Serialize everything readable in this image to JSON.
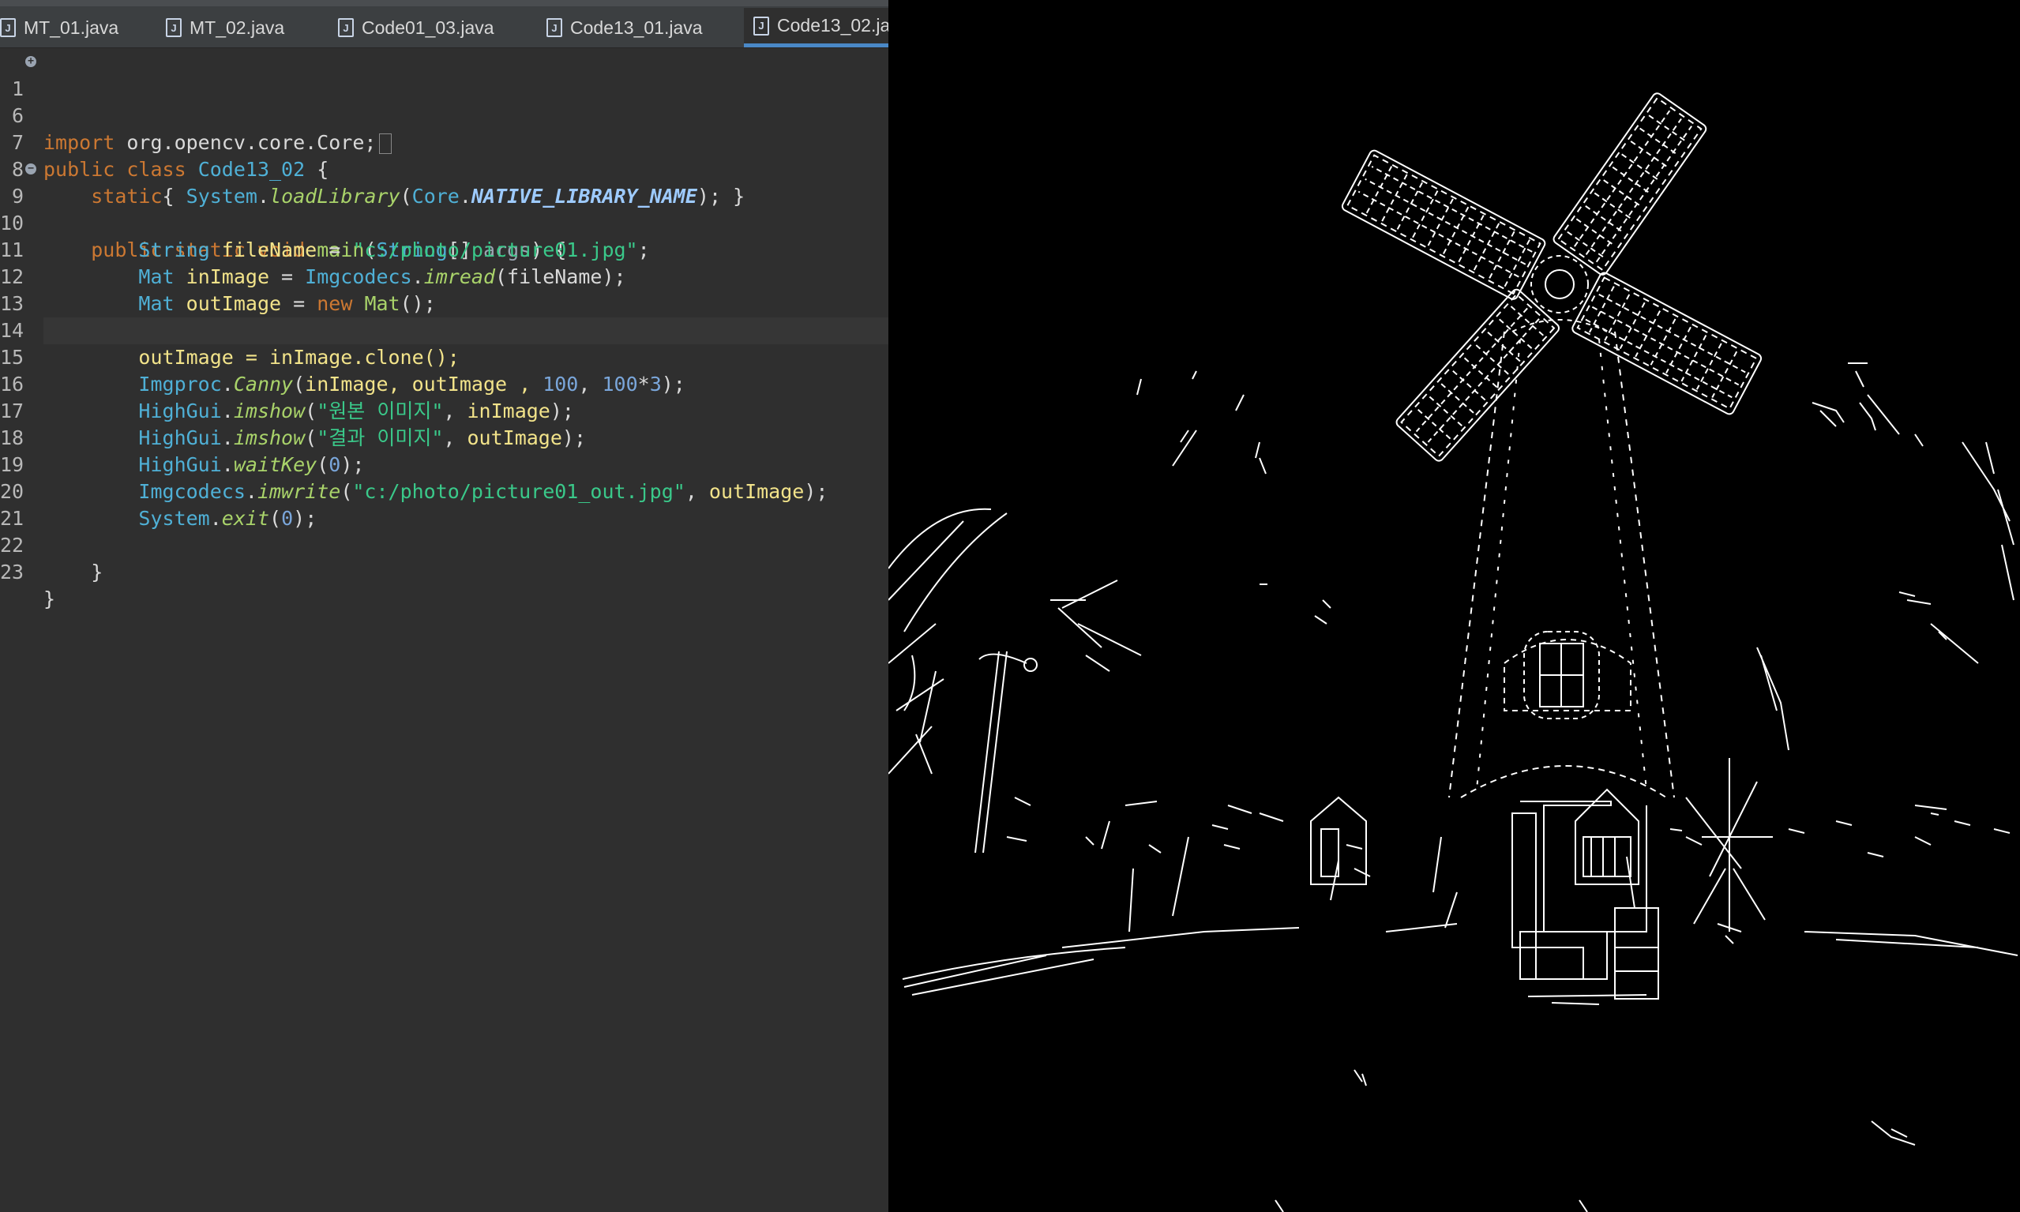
{
  "editor": {
    "tabs": [
      {
        "label": "MT_01.java"
      },
      {
        "label": "MT_02.java"
      },
      {
        "label": "Code01_03.java"
      },
      {
        "label": "Code13_01.java"
      },
      {
        "label": "Code13_02.ja",
        "active": true
      }
    ],
    "line_numbers": [
      "1",
      "6",
      "7",
      "8",
      "9",
      "10",
      "11",
      "12",
      "13",
      "14",
      "15",
      "16",
      "17",
      "18",
      "19",
      "20",
      "21",
      "22",
      "23"
    ],
    "code": {
      "l1_kw": "import",
      "l1_rest": " org.opencv.core.Core;",
      "l7_kw": "public class",
      "l7_cls": "Code13_02",
      "l7_rest": " {",
      "l8_kw": "static",
      "l8_a": "{ ",
      "l8_cls1": "System",
      "l8_fn": "loadLibrary",
      "l8_cls2": "Core",
      "l8_const": "NATIVE_LIBRARY_NAME",
      "l8_end": "); }",
      "l9_kw": "public static void",
      "l9_fn": "main",
      "l9_cls": "String",
      "l9_par": "args",
      "l9_end": ") {",
      "l10_cls": "String",
      "l10_var": "fileName",
      "l10_str": "\"c:/photo/picture01.jpg\"",
      "l11_cls1": "Mat",
      "l11_var": "inImage",
      "l11_cls2": "Imgcodecs",
      "l11_fn": "imread",
      "l11_end": "(fileName);",
      "l12_cls": "Mat",
      "l12_var": "outImage",
      "l12_kw": "new",
      "l12_cls2": "Mat",
      "l12_end": "();",
      "l14_text": "outImage = inImage.clone();",
      "l15_cls": "Imgproc",
      "l15_fn": "Canny",
      "l15_a": "inImage, outImage , ",
      "l15_n1": "100",
      "l15_n2": "100",
      "l15_n3": "3",
      "l16_cls": "HighGui",
      "l16_fn": "imshow",
      "l16_str": "\"원본 이미지\"",
      "l16_var": "inImage",
      "l17_cls": "HighGui",
      "l17_fn": "imshow",
      "l17_str": "\"결과 이미지\"",
      "l17_var": "outImage",
      "l18_cls": "HighGui",
      "l18_fn": "waitKey",
      "l18_num": "0",
      "l19_cls": "Imgcodecs",
      "l19_fn": "imwrite",
      "l19_str": "\"c:/photo/picture01_out.jpg\"",
      "l19_var": "outImage",
      "l20_cls": "System",
      "l20_fn": "exit",
      "l20_num": "0",
      "l22_text": "}",
      "l23_text": "}"
    }
  },
  "viewer": {
    "image": "canny-edge-windmill",
    "colors": {
      "background": "#000000",
      "edges": "#ffffff"
    }
  }
}
